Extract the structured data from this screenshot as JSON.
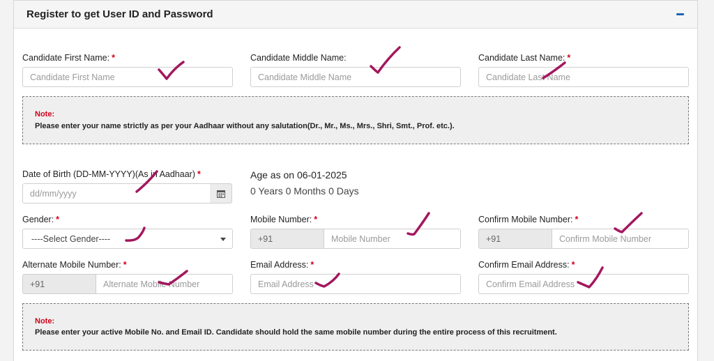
{
  "panel": {
    "title": "Register to get User ID and Password"
  },
  "name": {
    "first": {
      "label": "Candidate First Name:",
      "required": "*",
      "placeholder": "Candidate First Name"
    },
    "middle": {
      "label": "Candidate Middle Name:",
      "placeholder": "Candidate Middle Name"
    },
    "last": {
      "label": "Candidate Last Name:",
      "required": "*",
      "placeholder": "Candidate Last Name"
    }
  },
  "note1": {
    "title": "Note:",
    "text": "Please enter your name strictly as per your Aadhaar without any salutation(Dr., Mr., Ms., Mrs., Shri, Smt., Prof. etc.)."
  },
  "dob": {
    "label": "Date of Birth (DD-MM-YYYY)(As in Aadhaar)",
    "required": "*",
    "placeholder": "dd/mm/yyyy",
    "icon": "calendar-icon"
  },
  "age": {
    "title": "Age as on 06-01-2025",
    "value": "0 Years 0 Months 0 Days"
  },
  "gender": {
    "label": "Gender:",
    "required": "*",
    "selected": "----Select Gender----"
  },
  "mobile": {
    "label": "Mobile Number:",
    "required": "*",
    "prefix": "+91",
    "placeholder": "Mobile Number"
  },
  "confirm_mobile": {
    "label": "Confirm Mobile Number:",
    "required": "*",
    "prefix": "+91",
    "placeholder": "Confirm Mobile Number"
  },
  "alt_mobile": {
    "label": "Alternate Mobile Number:",
    "required": "*",
    "prefix": "+91",
    "placeholder": "Alternate Mobile Number"
  },
  "email": {
    "label": "Email Address:",
    "required": "*",
    "placeholder": "Email Address"
  },
  "confirm_email": {
    "label": "Confirm Email Address:",
    "required": "*",
    "placeholder": "Confirm Email Address"
  },
  "note2": {
    "title": "Note:",
    "text": "Please enter your active Mobile No. and Email ID. Candidate should hold the same mobile number during the entire process of this recruitment."
  },
  "colors": {
    "required": "#d0021b",
    "collapse": "#1f64b3",
    "annotation": "#a3175e"
  }
}
